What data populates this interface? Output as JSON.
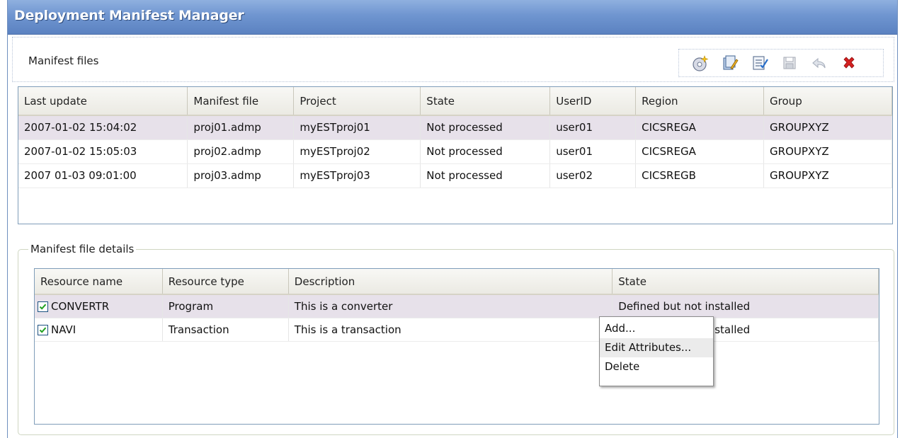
{
  "window": {
    "title": "Deployment Manifest Manager"
  },
  "manifest_section": {
    "label": "Manifest files",
    "toolbar": [
      {
        "icon": "new-manifest-icon",
        "name": "toolbar-new-button"
      },
      {
        "icon": "open-manifest-icon",
        "name": "toolbar-open-button"
      },
      {
        "icon": "edit-manifest-icon",
        "name": "toolbar-edit-button"
      },
      {
        "icon": "save-icon",
        "name": "toolbar-save-button"
      },
      {
        "icon": "undo-icon",
        "name": "toolbar-undo-button"
      },
      {
        "icon": "delete-icon",
        "name": "toolbar-delete-button"
      }
    ],
    "columns": [
      "Last update",
      "Manifest file",
      "Project",
      "State",
      "UserID",
      "Region",
      "Group"
    ],
    "rows": [
      [
        "2007-01-02 15:04:02",
        "proj01.admp",
        "myESTproj01",
        "Not processed",
        "user01",
        "CICSREGA",
        "GROUPXYZ"
      ],
      [
        "2007-01-02 15:05:03",
        "proj02.admp",
        "myESTproj02",
        "Not processed",
        "user01",
        "CICSREGA",
        "GROUPXYZ"
      ],
      [
        "2007 01-03 09:01:00",
        "proj03.admp",
        "myESTproj03",
        "Not processed",
        "user02",
        "CICSREGB",
        "GROUPXYZ"
      ]
    ]
  },
  "details_section": {
    "label": "Manifest file details",
    "columns": [
      "Resource name",
      "Resource type",
      "Description",
      "State"
    ],
    "rows": [
      {
        "checked": true,
        "cells": [
          "CONVERTR",
          "Program",
          "This is a converter",
          "Defined but not installed"
        ]
      },
      {
        "checked": true,
        "cells": [
          "NAVI",
          "Transaction",
          "This is a transaction",
          "Defined but not installed"
        ]
      }
    ]
  },
  "context_menu": {
    "items": [
      "Add...",
      "Edit Attributes...",
      "Delete"
    ]
  },
  "colors": {
    "titlebar": "#6f95d0",
    "selected_row": "#e7e1ea",
    "delete_icon": "#d42020"
  }
}
